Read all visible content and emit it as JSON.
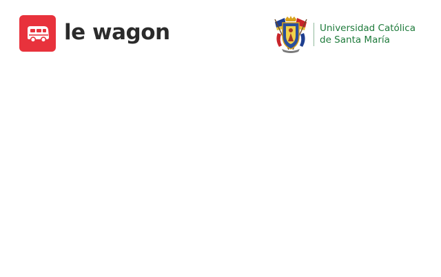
{
  "lewagon": {
    "wordmark": "le wagon",
    "icon": "bus-icon",
    "brand_color": "#e8323c",
    "text_color": "#2b2b2b"
  },
  "university": {
    "name_line1": "Universidad Católica",
    "name_line2": "de Santa María",
    "icon": "university-crest-icon",
    "brand_color": "#1d7a3a",
    "divider_color": "#8fb89b"
  }
}
